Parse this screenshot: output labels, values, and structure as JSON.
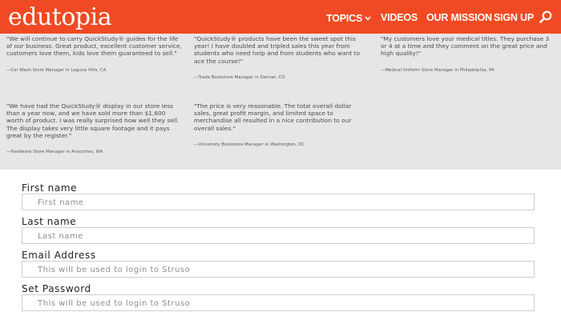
{
  "header": {
    "logo": "edutopia",
    "nav": [
      {
        "label": "TOPICS",
        "has_dropdown": true
      },
      {
        "label": "VIDEOS"
      },
      {
        "label": "OUR MISSION"
      },
      {
        "label": "SIGN UP"
      }
    ],
    "search_icon": "search-icon",
    "brand_color": "#ef4a23"
  },
  "testimonials": [
    {
      "text": "\"We will continue to carry QuickStudy® guides for the life of our business. Great product, excellent customer service, customers love them, kids love them guaranteed to sell.\"",
      "attribution": "—Car Wash Store Manager in Laguna Hills, CA"
    },
    {
      "text": "\"QuickStudy® products have been the sweet spot this year! I have doubled and tripled sales this year from students who need help and from students who want to ace the course!\"",
      "attribution": "—Trade Bookstore Manager in Denver, CO"
    },
    {
      "text": "\"My customers love your medical titles. They purchase 3 or 4 at a time and they comment on the great price and high quality!\"",
      "attribution": "—Medical Uniform Store Manager in Philadelphia, PA"
    },
    {
      "text": "\"We have had the QuickStudy® display in our store less than a year now, and we have sold more than $1,600 worth of product. I was really surprised how well they sell. The display takes very little square footage and it pays great by the register.\"",
      "attribution": "—Hardware Store Manager in Anacortes, WA"
    },
    {
      "text": "\"The price is very reasonable. The total overall dollar sales, great profit margin, and limited space to merchandise all resulted in a nice contribution to our overall sales.\"",
      "attribution": "—University Bookstore Manager in Washington, DC"
    }
  ],
  "form": {
    "first_name": {
      "label": "First name",
      "placeholder": "First name",
      "value": ""
    },
    "last_name": {
      "label": "Last name",
      "placeholder": "Last name",
      "value": ""
    },
    "email": {
      "label": "Email Address",
      "placeholder": "This will be used to login to Struso",
      "value": ""
    },
    "password": {
      "label": "Set Password",
      "placeholder": "This will be used to login to Struso",
      "value": ""
    }
  }
}
